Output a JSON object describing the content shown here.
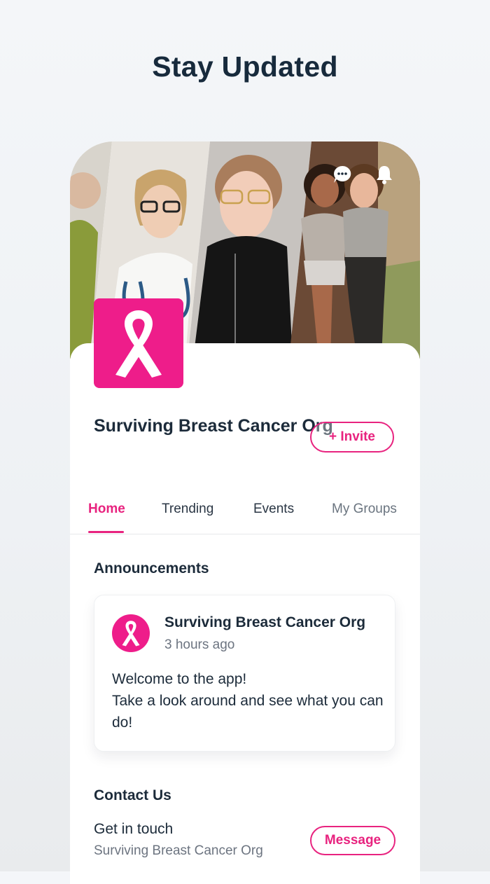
{
  "headline": "Stay Updated",
  "header_icons": [
    "chat-bubble-icon",
    "bell-icon"
  ],
  "org": {
    "name": "Surviving Breast Cancer Org",
    "logo_icon": "pink-ribbon-icon",
    "brand_color": "#ee1d8a",
    "invite_label": "+ Invite"
  },
  "tabs": [
    {
      "label": "Home",
      "active": true
    },
    {
      "label": "Trending",
      "active": false
    },
    {
      "label": "Events",
      "active": false
    },
    {
      "label": "My Groups",
      "active": false
    }
  ],
  "announcements": {
    "title": "Announcements",
    "post": {
      "author": "Surviving Breast Cancer Org",
      "time": "3 hours ago",
      "body_line1": "Welcome to the app!",
      "body_line2": "Take a look around and see what you can do!"
    }
  },
  "contact": {
    "title": "Contact Us",
    "subtitle": "Get in touch",
    "org": "Surviving Breast Cancer Org",
    "button_label": "Message"
  }
}
